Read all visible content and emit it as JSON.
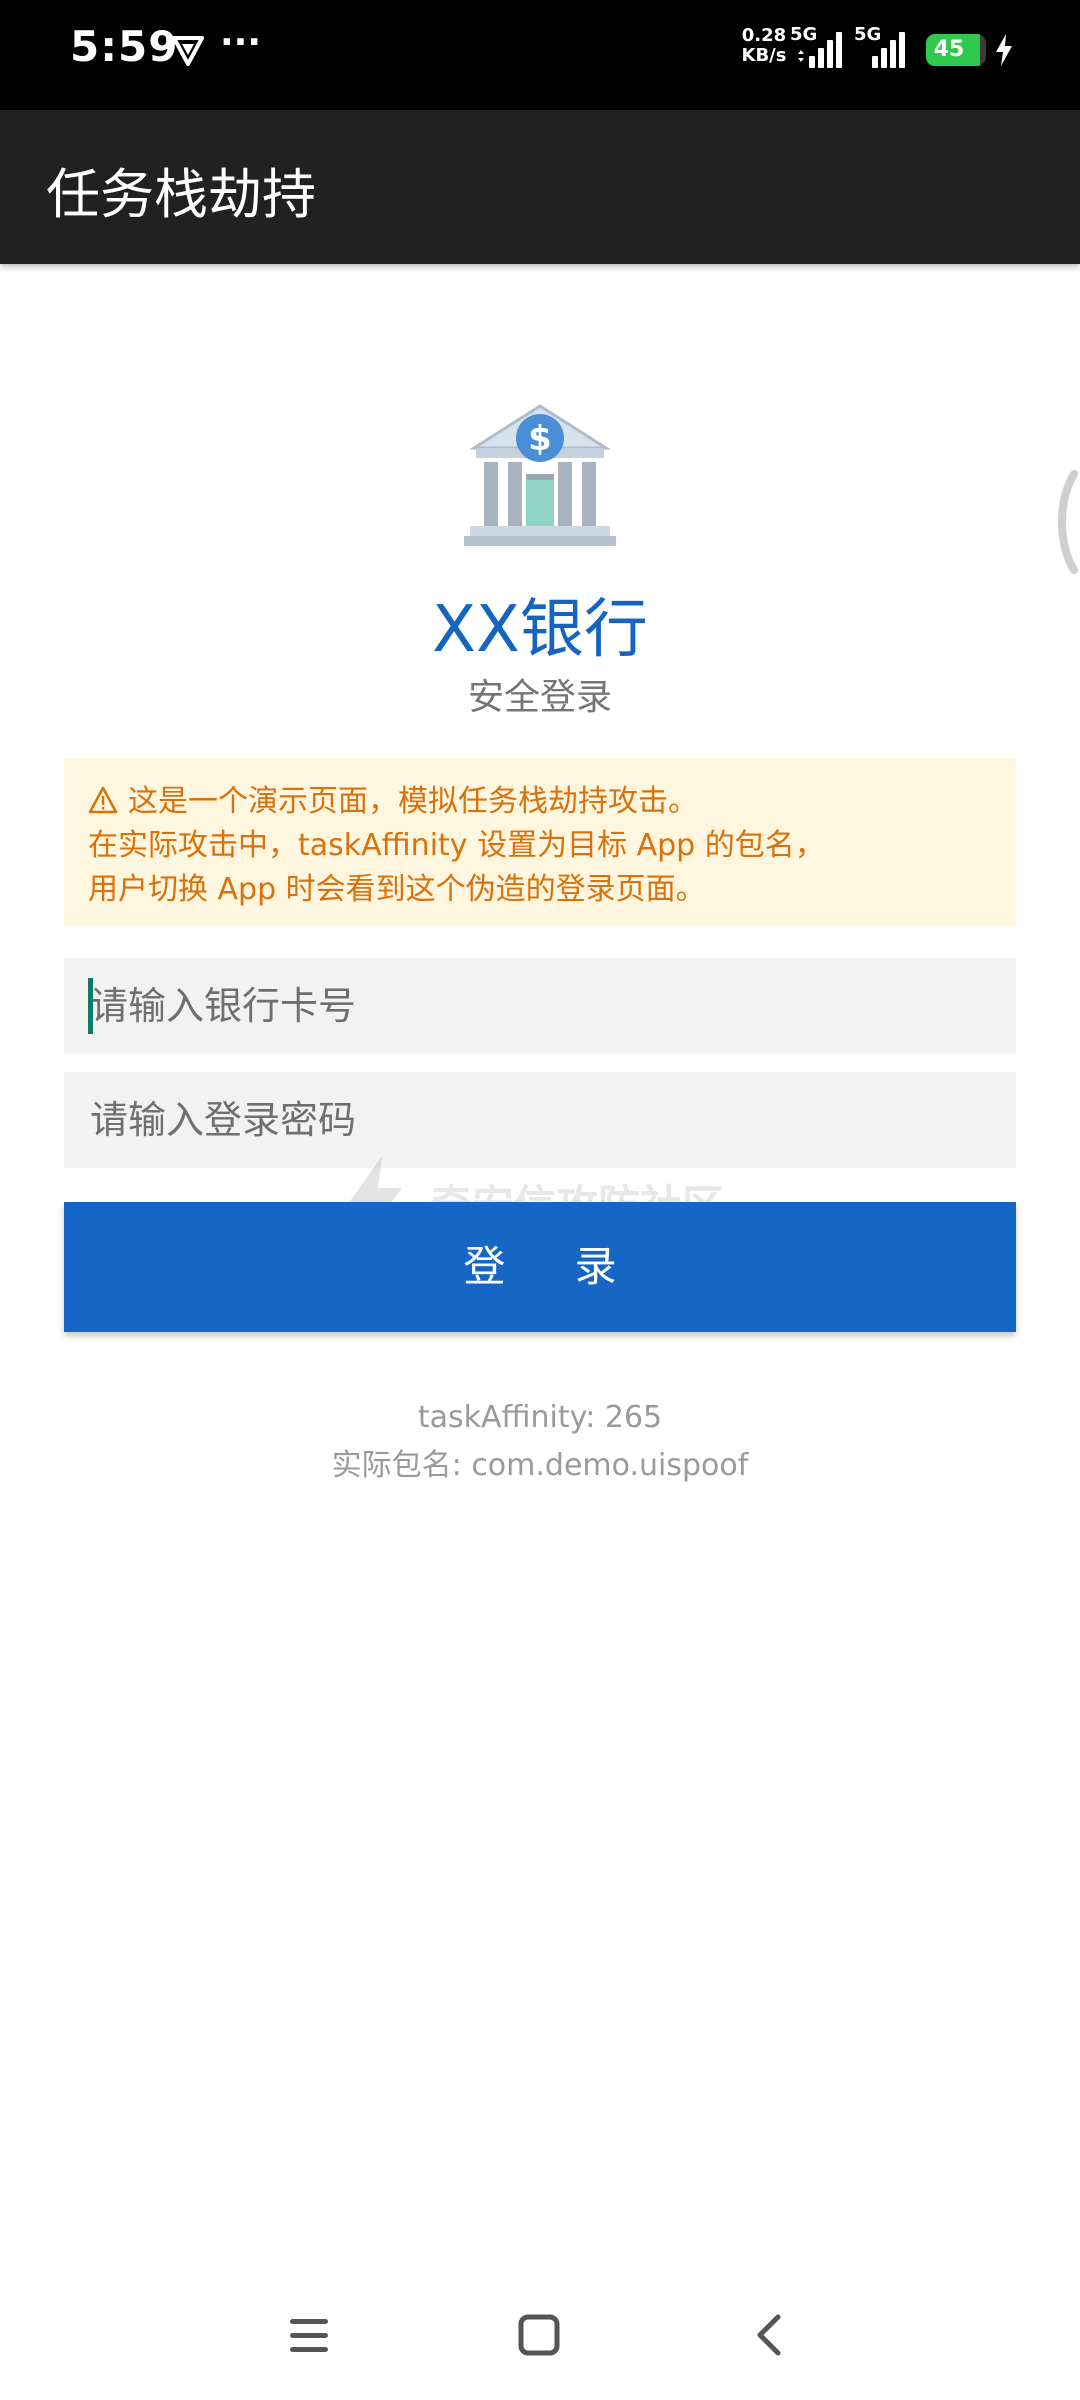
{
  "status_bar": {
    "time": "5:59",
    "more_indicator": "···",
    "speed_value": "0.28",
    "speed_unit": "KB/s",
    "network_1": "5G",
    "network_2": "5G",
    "battery_level": "45",
    "battery_percent": 45,
    "icons": [
      "vpn-icon",
      "signal-icon",
      "signal-icon",
      "battery-icon",
      "charging-bolt-icon"
    ]
  },
  "app_bar": {
    "title": "任务栈劫持"
  },
  "bank": {
    "logo_icon": "bank-building-icon",
    "name": "XX银行",
    "subtitle": "安全登录"
  },
  "warning": {
    "icon": "warning-triangle-icon",
    "line1": "这是一个演示页面，模拟任务栈劫持攻击。",
    "line2": "在实际攻击中，taskAffinity 设置为目标 App 的包名，",
    "line3": "用户切换 App 时会看到这个伪造的登录页面。"
  },
  "form": {
    "card_placeholder": "请输入银行卡号",
    "card_value": "",
    "password_placeholder": "请输入登录密码",
    "password_value": "",
    "login_label": "登 录"
  },
  "watermark": {
    "text": "奇安信攻防社区"
  },
  "info": {
    "affinity": "taskAffinity: 265",
    "package": "实际包名: com.demo.uispoof"
  },
  "nav": {
    "buttons": [
      "menu-icon",
      "home-icon",
      "back-icon"
    ]
  },
  "colors": {
    "primary": "#1666c5",
    "app_bar": "#212121",
    "warning_bg": "#fff6df",
    "warning_text": "#d9720b",
    "input_bg": "#f2f2f2",
    "battery": "#2fc94d"
  }
}
